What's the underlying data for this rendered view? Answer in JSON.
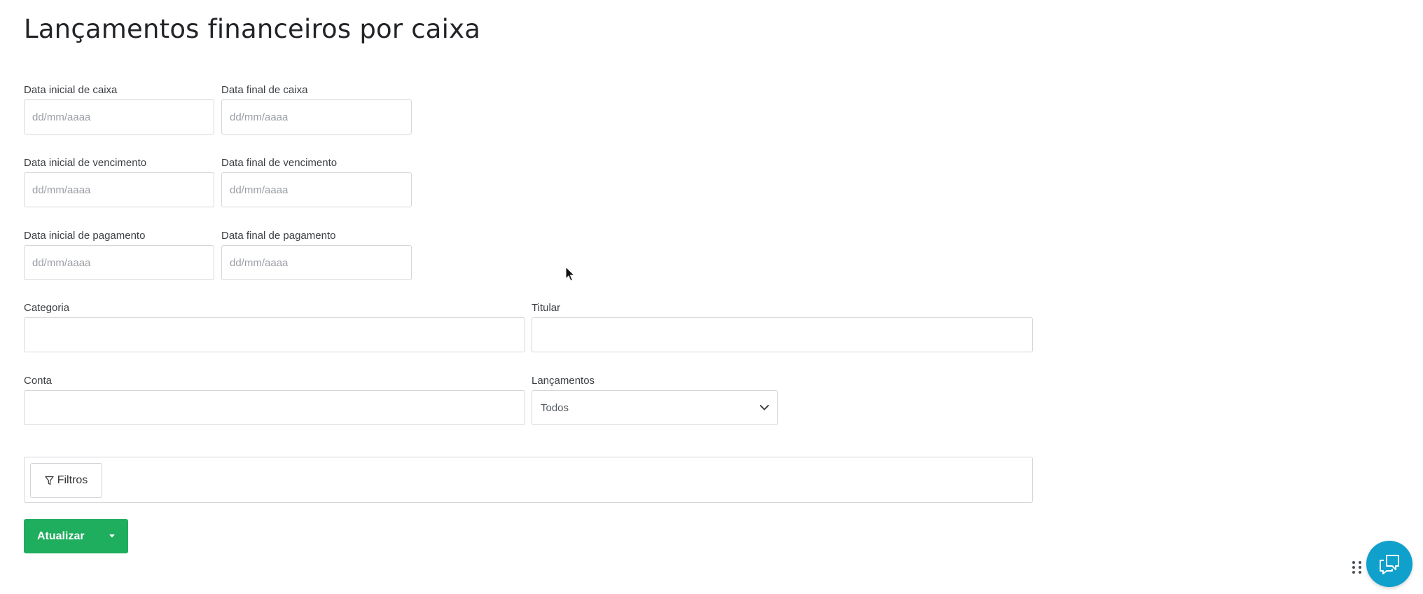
{
  "page": {
    "title": "Lançamentos financeiros por caixa"
  },
  "form": {
    "cash_start": {
      "label": "Data inicial de caixa",
      "placeholder": "dd/mm/aaaa",
      "value": ""
    },
    "cash_end": {
      "label": "Data final de caixa",
      "placeholder": "dd/mm/aaaa",
      "value": ""
    },
    "due_start": {
      "label": "Data inicial de vencimento",
      "placeholder": "dd/mm/aaaa",
      "value": ""
    },
    "due_end": {
      "label": "Data final de vencimento",
      "placeholder": "dd/mm/aaaa",
      "value": ""
    },
    "payment_start": {
      "label": "Data inicial de pagamento",
      "placeholder": "dd/mm/aaaa",
      "value": ""
    },
    "payment_end": {
      "label": "Data final de pagamento",
      "placeholder": "dd/mm/aaaa",
      "value": ""
    },
    "category": {
      "label": "Categoria",
      "value": ""
    },
    "holder": {
      "label": "Titular",
      "value": ""
    },
    "account": {
      "label": "Conta",
      "value": ""
    },
    "entries": {
      "label": "Lançamentos",
      "selected": "Todos"
    }
  },
  "filters": {
    "button_label": "Filtros"
  },
  "actions": {
    "update_label": "Atualizar"
  },
  "colors": {
    "primary_green": "#1fad5e",
    "chat_blue": "#0fa0cc",
    "border": "#d4d6da"
  },
  "icons": {
    "filter": "funnel-icon",
    "dropdown": "chevron-down-icon",
    "update_dropdown": "caret-down-icon",
    "chat": "chat-bubble-icon",
    "drag": "drag-handle-icon"
  }
}
